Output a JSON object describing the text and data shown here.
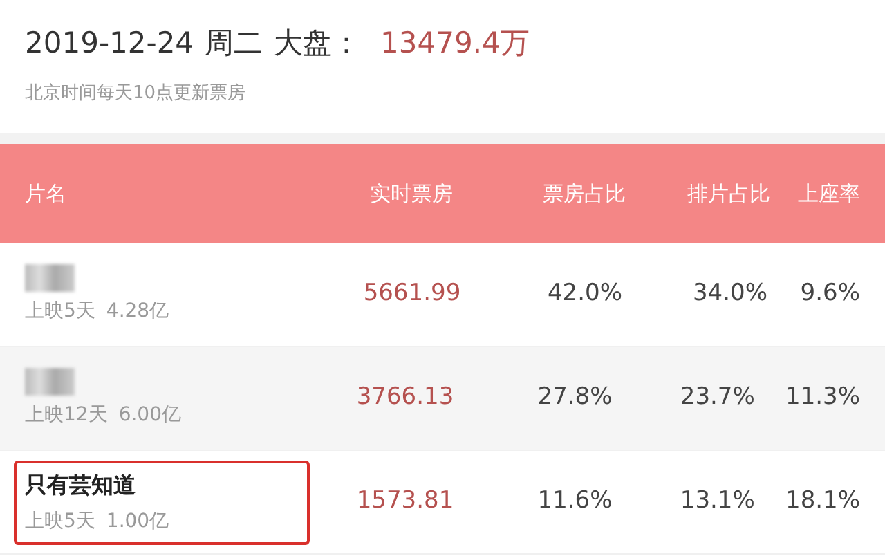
{
  "header": {
    "date": "2019-12-24",
    "weekday": "周二",
    "market_label": "大盘：",
    "market_value": "13479.4万",
    "note": "北京时间每天10点更新票房"
  },
  "table": {
    "columns": [
      "片名",
      "实时票房",
      "票房占比",
      "排片占比",
      "上座率"
    ],
    "rows": [
      {
        "title_blurred": true,
        "title": "",
        "release": "上映5天",
        "total": "4.28亿",
        "box_office": "5661.99",
        "box_share": "42.0%",
        "screening_share": "34.0%",
        "occupancy": "9.6%",
        "highlighted": false
      },
      {
        "title_blurred": true,
        "title": "",
        "release": "上映12天",
        "total": "6.00亿",
        "box_office": "3766.13",
        "box_share": "27.8%",
        "screening_share": "23.7%",
        "occupancy": "11.3%",
        "highlighted": false
      },
      {
        "title_blurred": false,
        "title": "只有芸知道",
        "release": "上映5天",
        "total": "1.00亿",
        "box_office": "1573.81",
        "box_share": "11.6%",
        "screening_share": "13.1%",
        "occupancy": "18.1%",
        "highlighted": true
      }
    ]
  }
}
